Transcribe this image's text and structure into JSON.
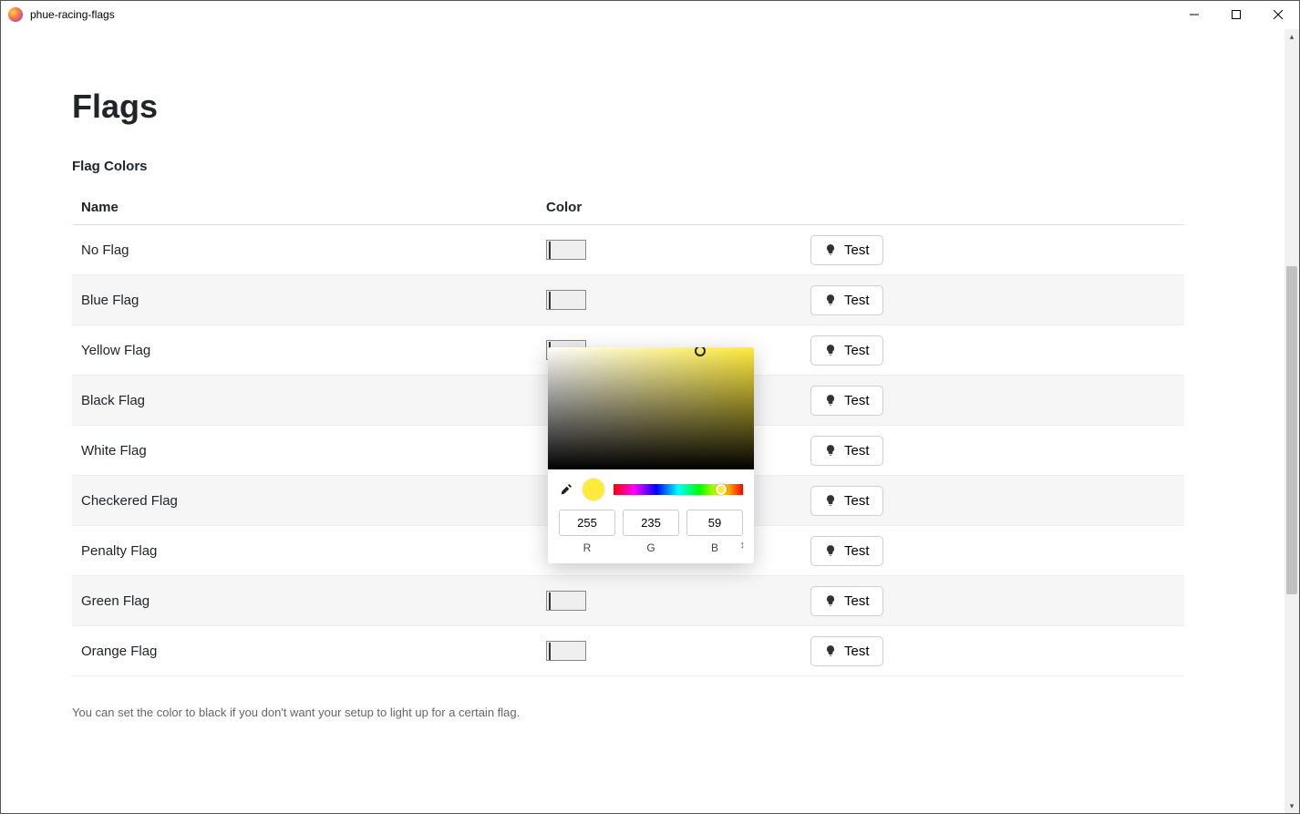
{
  "window": {
    "title": "phue-racing-flags"
  },
  "page": {
    "heading": "Flags",
    "section_label": "Flag Colors",
    "columns": {
      "name": "Name",
      "color": "Color"
    },
    "hint": "You can set the color to black if you don't want your setup to light up for a certain flag."
  },
  "test_button_label": "Test",
  "flags": [
    {
      "name": "No Flag",
      "color": "#000000"
    },
    {
      "name": "Blue Flag",
      "color": "#143a9a"
    },
    {
      "name": "Yellow Flag",
      "color": "#ffeb3b"
    },
    {
      "name": "Black Flag",
      "color": "#000000"
    },
    {
      "name": "White Flag",
      "color": "#ffffff"
    },
    {
      "name": "Checkered Flag",
      "color": "#000000"
    },
    {
      "name": "Penalty Flag",
      "color": "#000000"
    },
    {
      "name": "Green Flag",
      "color": "#2e8a3b"
    },
    {
      "name": "Orange Flag",
      "color": "#ef6c00"
    }
  ],
  "picker": {
    "open_for_index": 2,
    "preview_color": "#ffeb3b",
    "r": "255",
    "g": "235",
    "b": "59",
    "labels": {
      "r": "R",
      "g": "G",
      "b": "B"
    }
  }
}
